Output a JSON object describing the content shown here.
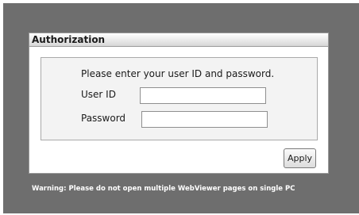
{
  "panel": {
    "title": "Authorization"
  },
  "form": {
    "instruction": "Please enter your user ID and password.",
    "user_id_label": "User ID",
    "user_id_value": "",
    "password_label": "Password",
    "password_value": ""
  },
  "apply_label": "Apply",
  "warning": "Warning: Please do not open multiple WebViewer pages on single PC"
}
